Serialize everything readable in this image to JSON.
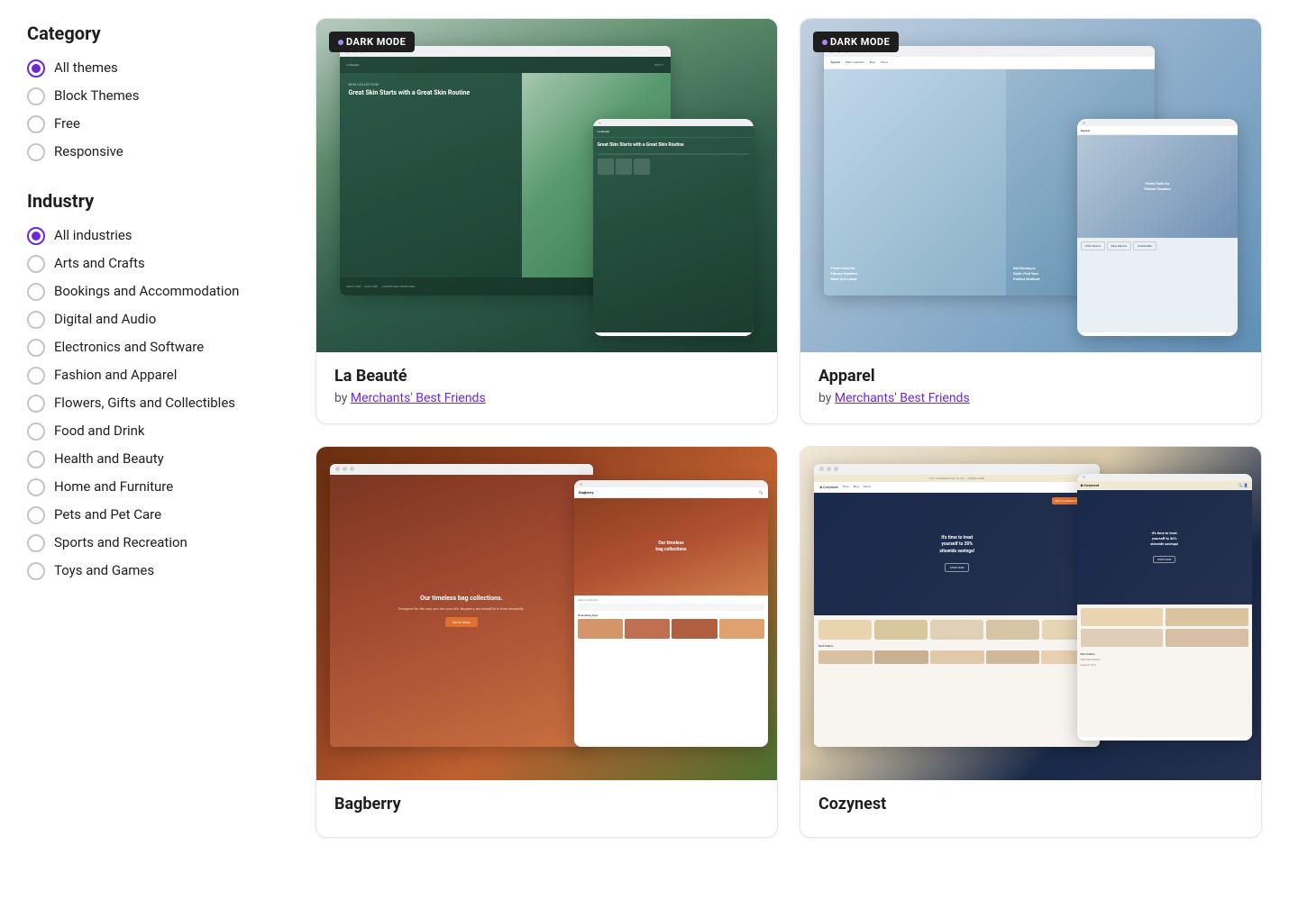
{
  "sidebar": {
    "category_title": "Category",
    "industry_title": "Industry",
    "category_items": [
      {
        "label": "All themes",
        "value": "all",
        "checked": true
      },
      {
        "label": "Block Themes",
        "value": "block",
        "checked": false
      },
      {
        "label": "Free",
        "value": "free",
        "checked": false
      },
      {
        "label": "Responsive",
        "value": "responsive",
        "checked": false
      }
    ],
    "industry_items": [
      {
        "label": "All industries",
        "value": "all",
        "checked": true
      },
      {
        "label": "Arts and Crafts",
        "value": "arts",
        "checked": false
      },
      {
        "label": "Bookings and Accommodation",
        "value": "bookings",
        "checked": false
      },
      {
        "label": "Digital and Audio",
        "value": "digital",
        "checked": false
      },
      {
        "label": "Electronics and Software",
        "value": "electronics",
        "checked": false
      },
      {
        "label": "Fashion and Apparel",
        "value": "fashion",
        "checked": false
      },
      {
        "label": "Flowers, Gifts and Collectibles",
        "value": "flowers",
        "checked": false
      },
      {
        "label": "Food and Drink",
        "value": "food",
        "checked": false
      },
      {
        "label": "Health and Beauty",
        "value": "health",
        "checked": false
      },
      {
        "label": "Home and Furniture",
        "value": "home",
        "checked": false
      },
      {
        "label": "Pets and Pet Care",
        "value": "pets",
        "checked": false
      },
      {
        "label": "Sports and Recreation",
        "value": "sports",
        "checked": false
      },
      {
        "label": "Toys and Games",
        "value": "toys",
        "checked": false
      }
    ]
  },
  "themes": [
    {
      "name": "La Beauté",
      "author": "Merchants' Best Friends",
      "badge": "DARK MODE",
      "id": "labeaute"
    },
    {
      "name": "Apparel",
      "author": "Merchants' Best Friends",
      "badge": "DARK MODE",
      "id": "apparel"
    },
    {
      "name": "Bagberry",
      "author": "",
      "badge": null,
      "id": "bagberry"
    },
    {
      "name": "Cozynest",
      "author": "",
      "badge": null,
      "id": "cozynest"
    }
  ],
  "badges": {
    "dark_mode": "DARK MODE"
  }
}
